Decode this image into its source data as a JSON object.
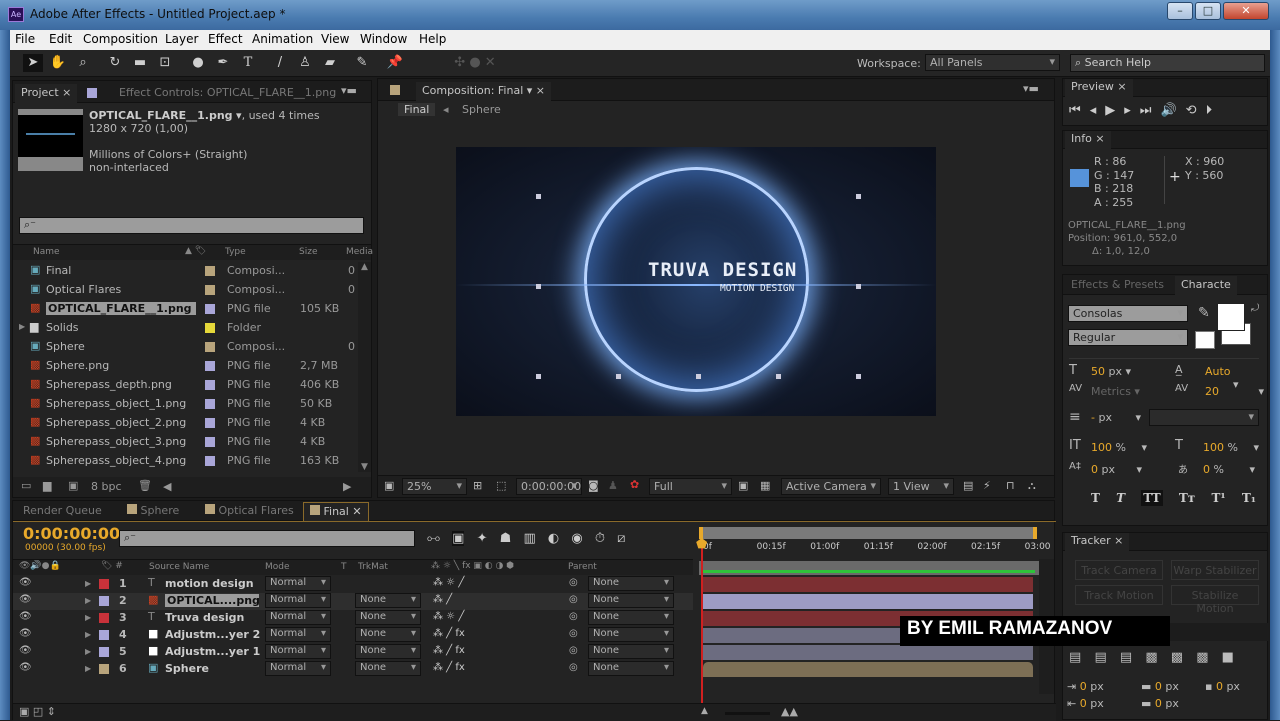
{
  "app": {
    "title": "Adobe After Effects - Untitled Project.aep *",
    "logo": "Ae"
  },
  "menu": [
    "File",
    "Edit",
    "Composition",
    "Layer",
    "Effect",
    "Animation",
    "View",
    "Window",
    "Help"
  ],
  "toolbar": {
    "workspace_label": "Workspace:",
    "workspace_value": "All Panels",
    "search_placeholder": "Search Help"
  },
  "project": {
    "tab_project": "Project",
    "tab_effect_controls": "Effect Controls: OPTICAL_FLARE__1.png",
    "selected_name": "OPTICAL_FLARE__1.png",
    "used": ", used 4 times",
    "dims": "1280 x 720 (1,00)",
    "colors": "Millions of Colors+ (Straight)",
    "interlace": "non-interlaced",
    "columns": {
      "name": "Name",
      "type": "Type",
      "size": "Size",
      "media": "Media"
    },
    "items": [
      {
        "name": "Final",
        "type": "Composi...",
        "size": "",
        "extra": "0",
        "icon": "comp",
        "color": "#b8a47c"
      },
      {
        "name": "Optical Flares",
        "type": "Composi...",
        "size": "",
        "extra": "0",
        "icon": "comp",
        "color": "#b8a47c"
      },
      {
        "name": "OPTICAL_FLARE__1.png",
        "type": "PNG file",
        "size": "105 KB",
        "extra": "",
        "icon": "png",
        "color": "#a9a6d8",
        "selected": true
      },
      {
        "name": "Solids",
        "type": "Folder",
        "size": "",
        "extra": "",
        "icon": "folder",
        "color": "#e5d83a"
      },
      {
        "name": "Sphere",
        "type": "Composi...",
        "size": "",
        "extra": "0",
        "icon": "comp",
        "color": "#b8a47c"
      },
      {
        "name": "Sphere.png",
        "type": "PNG file",
        "size": "2,7 MB",
        "extra": "",
        "icon": "png",
        "color": "#a9a6d8"
      },
      {
        "name": "Spherepass_depth.png",
        "type": "PNG file",
        "size": "406 KB",
        "extra": "",
        "icon": "png",
        "color": "#a9a6d8"
      },
      {
        "name": "Spherepass_object_1.png",
        "type": "PNG file",
        "size": "50 KB",
        "extra": "",
        "icon": "png",
        "color": "#a9a6d8"
      },
      {
        "name": "Spherepass_object_2.png",
        "type": "PNG file",
        "size": "4 KB",
        "extra": "",
        "icon": "png",
        "color": "#a9a6d8"
      },
      {
        "name": "Spherepass_object_3.png",
        "type": "PNG file",
        "size": "4 KB",
        "extra": "",
        "icon": "png",
        "color": "#a9a6d8"
      },
      {
        "name": "Spherepass_object_4.png",
        "type": "PNG file",
        "size": "163 KB",
        "extra": "",
        "icon": "png",
        "color": "#a9a6d8"
      }
    ],
    "bpc": "8 bpc"
  },
  "comp": {
    "tab": "Composition: Final",
    "crumbs": [
      "Final",
      "Sphere"
    ],
    "title_text": "TRUVA DESIGN",
    "subtitle_text": "MOTION DESIGN",
    "zoom": "25%",
    "timecode": "0:00:00:00",
    "resolution": "Full",
    "camera": "Active Camera",
    "views": "1 View"
  },
  "preview": {
    "tab": "Preview"
  },
  "info": {
    "tab": "Info",
    "r": "R : 86",
    "g": "G : 147",
    "b": "B : 218",
    "a": "A : 255",
    "x": "X : 960",
    "y": "Y : 560",
    "swatch": "#5693da",
    "line1": "OPTICAL_FLARE__1.png",
    "line2": "Position: 961,0, 552,0",
    "line3": "Δ: 1,0, 12,0"
  },
  "character": {
    "tab_effects": "Effects & Presets",
    "tab_character": "Characte",
    "font": "Consolas",
    "style": "Regular",
    "size": "50",
    "size_unit": "px",
    "leading": "Auto",
    "kerning": "Metrics",
    "tracking": "20",
    "stroke": "-",
    "stroke_unit": "px",
    "vscale": "100",
    "hscale": "100",
    "pct": "%",
    "baseline": "0",
    "baseline_unit": "px",
    "tsume": "0",
    "tsume_unit": "%"
  },
  "tracker": {
    "tab": "Tracker",
    "buttons": [
      "Track Camera",
      "Warp Stabilizer",
      "Track Motion",
      "Stabilize Motion"
    ]
  },
  "paragraph": {
    "values": [
      "0",
      "0",
      "0",
      "0",
      "0"
    ],
    "unit": "px"
  },
  "timeline": {
    "tabs": [
      "Render Queue",
      "Sphere",
      "Optical Flares",
      "Final"
    ],
    "timecode": "0:00:00:00",
    "fps": "00000 (30.00 fps)",
    "headers": {
      "source": "Source Name",
      "mode": "Mode",
      "t": "T",
      "trkmat": "TrkMat",
      "parent": "Parent"
    },
    "ruler": [
      "0f",
      "00:15f",
      "01:00f",
      "01:15f",
      "02:00f",
      "02:15f",
      "03:00"
    ],
    "layers": [
      {
        "num": "1",
        "name": "motion design",
        "mode": "Normal",
        "trkmat": "",
        "parent": "None",
        "color": "#c8323a",
        "icon": "text",
        "bar": "#7c2f32"
      },
      {
        "num": "2",
        "name": "OPTICAL....png",
        "mode": "Normal",
        "trkmat": "None",
        "parent": "None",
        "color": "#a9a6d8",
        "icon": "png",
        "bar": "#9d9bc4",
        "selected": true
      },
      {
        "num": "3",
        "name": "Truva design",
        "mode": "Normal",
        "trkmat": "None",
        "parent": "None",
        "color": "#c8323a",
        "icon": "text",
        "bar": "#7c2f32"
      },
      {
        "num": "4",
        "name": "Adjustm...yer 2",
        "mode": "Normal",
        "trkmat": "None",
        "parent": "None",
        "color": "#a9a6d8",
        "icon": "solid",
        "bar": "#6c6c80"
      },
      {
        "num": "5",
        "name": "Adjustm...yer 1",
        "mode": "Normal",
        "trkmat": "None",
        "parent": "None",
        "color": "#a9a6d8",
        "icon": "solid",
        "bar": "#6c6c80"
      },
      {
        "num": "6",
        "name": "Sphere",
        "mode": "Normal",
        "trkmat": "None",
        "parent": "None",
        "color": "#b8a47c",
        "icon": "comp",
        "bar": "#7d6f55"
      }
    ]
  },
  "watermark": "BY EMIL RAMAZANOV"
}
